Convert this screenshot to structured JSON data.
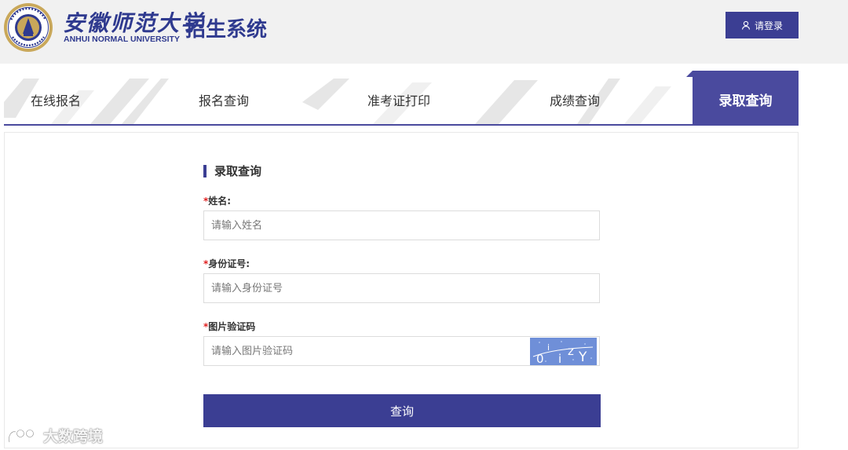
{
  "header": {
    "logo_cn": "安徽师范大学",
    "logo_en": "ANHUI NORMAL UNIVERSITY",
    "system_title": "招生系统",
    "login_label": "请登录"
  },
  "nav": {
    "items": [
      {
        "label": "在线报名"
      },
      {
        "label": "报名查询"
      },
      {
        "label": "准考证打印"
      },
      {
        "label": "成绩查询"
      }
    ],
    "active_label": "录取查询"
  },
  "form": {
    "title": "录取查询",
    "required_mark": "*",
    "name": {
      "label": "姓名:",
      "placeholder": "请输入姓名",
      "value": ""
    },
    "id_card": {
      "label": "身份证号:",
      "placeholder": "请输入身份证号",
      "value": ""
    },
    "captcha": {
      "label": "图片验证码",
      "placeholder": "请输入图片验证码",
      "value": "",
      "image_text": "0 i i z Y"
    },
    "submit_label": "查询"
  },
  "watermark": {
    "text": "大数跨境"
  },
  "colors": {
    "primary": "#3b3e93",
    "nav_active": "#4a4a9e",
    "header_bg": "#f1f1f1",
    "required": "#e02020",
    "captcha_bg": "#6f8fd8"
  },
  "icons": {
    "login": "user-icon",
    "logo": "university-seal-icon",
    "watermark": "brand-logo-icon"
  }
}
